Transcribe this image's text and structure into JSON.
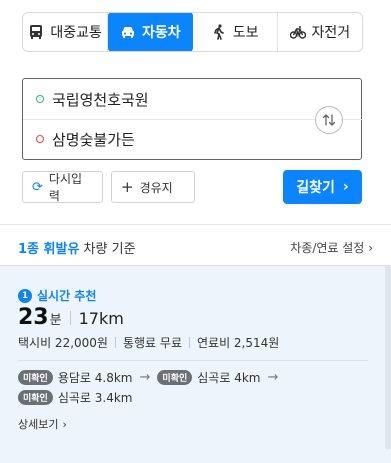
{
  "tabs": [
    {
      "label": "대중교통",
      "icon": "bus-icon",
      "active": false
    },
    {
      "label": "자동차",
      "icon": "car-icon",
      "active": true
    },
    {
      "label": "도보",
      "icon": "walk-icon",
      "active": false
    },
    {
      "label": "자전거",
      "icon": "bike-icon",
      "active": false
    }
  ],
  "route": {
    "start": "국립영천호국원",
    "end": "삼명숯불가든"
  },
  "actions": {
    "reset": "다시입력",
    "waypoint": "경유지",
    "search": "길찾기"
  },
  "vehicle": {
    "highlight": "1종 휘발유",
    "suffix": " 차량 기준",
    "setting": "차종/연료 설정"
  },
  "result": {
    "rank": "1",
    "rank_label": "실시간 추천",
    "time_value": "23",
    "time_unit": "분",
    "distance": "17km",
    "taxi": "택시비 22,000원",
    "toll": "통행료 무료",
    "fuel": "연료비 2,514원",
    "roads": [
      {
        "tag": "미확인",
        "text": "용담로 4.8km"
      },
      {
        "tag": "미확인",
        "text": "심곡로 4km"
      },
      {
        "tag": "미확인",
        "text": "심곡로 3.4km"
      }
    ],
    "detail": "상세보기"
  },
  "colors": {
    "accent": "#0a84ff",
    "start_dot": "#1fbf75",
    "end_dot": "#ff3b4d",
    "result_bg": "#eef4fb"
  }
}
